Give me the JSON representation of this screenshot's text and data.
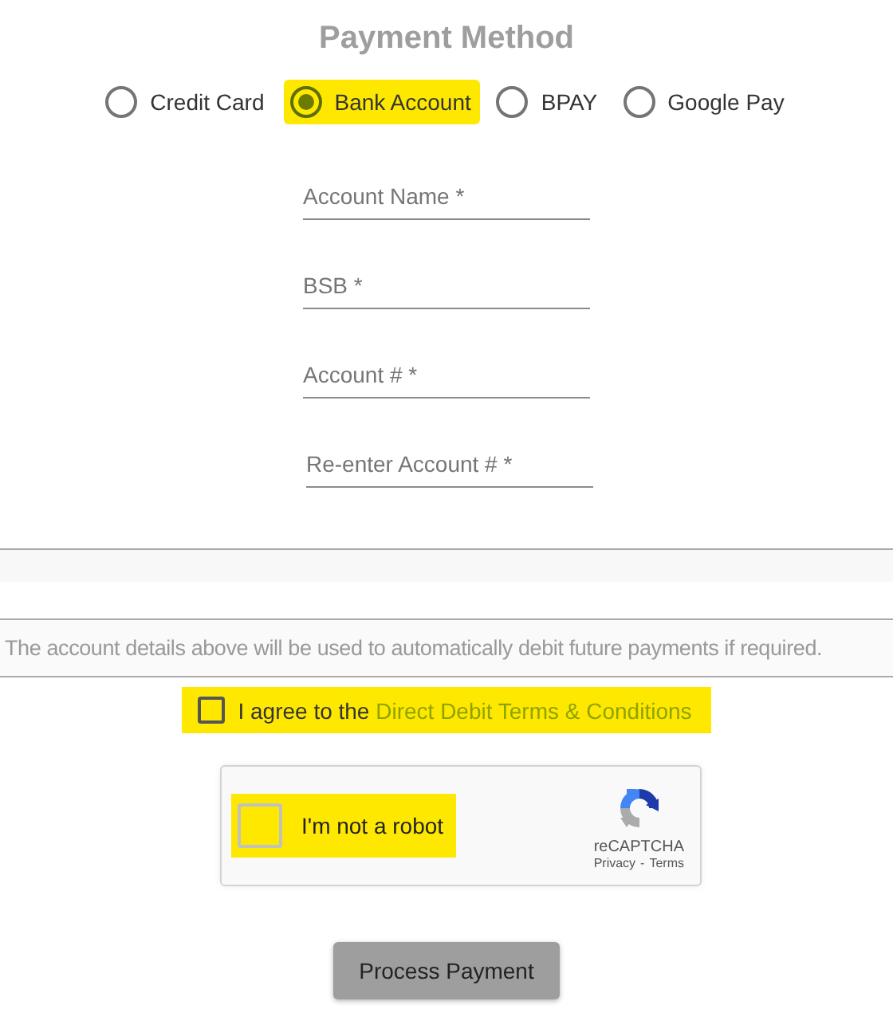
{
  "title": "Payment Method",
  "payment_options": [
    {
      "label": "Credit Card",
      "selected": false,
      "highlighted": false
    },
    {
      "label": "Bank Account",
      "selected": true,
      "highlighted": true
    },
    {
      "label": "BPAY",
      "selected": false,
      "highlighted": false
    },
    {
      "label": "Google Pay",
      "selected": false,
      "highlighted": false
    }
  ],
  "fields": [
    {
      "placeholder": "Account Name *"
    },
    {
      "placeholder": "BSB *"
    },
    {
      "placeholder": "Account # *"
    },
    {
      "placeholder": "Re-enter Account # *"
    }
  ],
  "notice": "The account details above will be used to automatically debit future payments if required.",
  "agreement": {
    "text": "I agree to the",
    "link": "Direct Debit Terms & Conditions",
    "checked": false,
    "highlighted": true
  },
  "captcha": {
    "label": "I'm not a robot",
    "checked": false,
    "highlighted": true,
    "brand": "reCAPTCHA",
    "privacy": "Privacy",
    "separator": "-",
    "terms": "Terms"
  },
  "submit_button": "Process Payment"
}
